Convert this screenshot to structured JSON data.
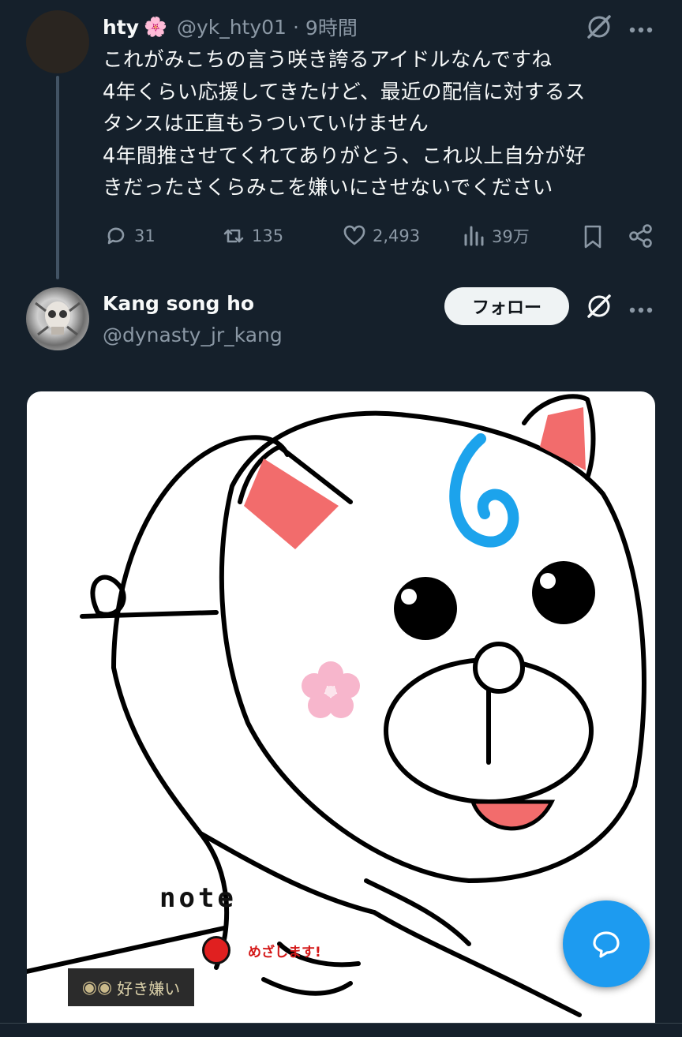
{
  "tweet1": {
    "display_name": "hty",
    "name_emoji": "🌸",
    "handle": "@yk_hty01",
    "separator": "·",
    "time": "9時間",
    "text_lines": [
      "これがみこちの言う咲き誇るアイドルなんですね",
      "4年くらい応援してきたけど、最近の配信に対するス",
      "タンスは正直もうついていけません",
      "4年間推させてくれてありがとう、これ以上自分が好",
      "きだったさくらみこを嫌いにさせないでください"
    ],
    "replies": "31",
    "retweets": "135",
    "likes": "2,493",
    "views": "39万"
  },
  "tweet2": {
    "display_name": "Kang song ho",
    "handle": "@dynasty_jr_kang",
    "follow_label": "フォロー",
    "image_texts": {
      "note": "note",
      "mezamashi": "めざします!",
      "badge": "好き嫌い"
    }
  },
  "icons": [
    "grok-icon",
    "more-icon",
    "reply-icon",
    "retweet-icon",
    "like-icon",
    "views-icon",
    "bookmark-icon",
    "share-icon",
    "compose-icon"
  ],
  "colors": {
    "background": "#15202b",
    "muted": "#8b98a5",
    "accent": "#1d9bf0",
    "follow_bg": "#eff3f4"
  }
}
